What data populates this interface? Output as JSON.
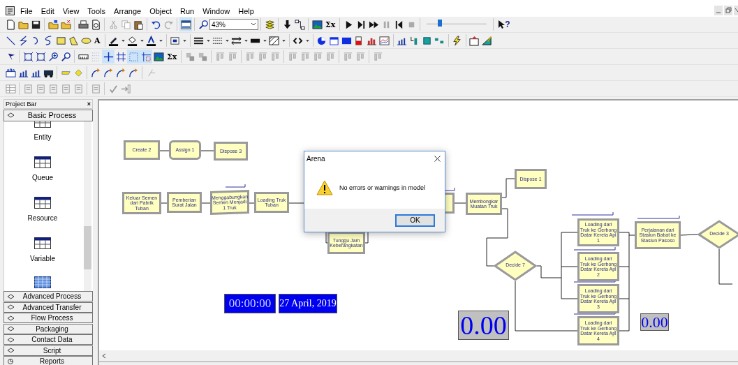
{
  "menu": [
    "File",
    "Edit",
    "View",
    "Tools",
    "Arrange",
    "Object",
    "Run",
    "Window",
    "Help"
  ],
  "toolbar": {
    "zoom": "43%",
    "speed_slider": {
      "level": 0.22
    },
    "glyphs": [
      "Σx",
      "A",
      "Σx",
      "?"
    ]
  },
  "project_bar": {
    "title": "Project Bar",
    "close": "×",
    "panels": [
      {
        "label": "Basic Process",
        "kind": "template",
        "expanded": true,
        "items": [
          "Entity",
          "Queue",
          "Resource",
          "Variable"
        ]
      },
      {
        "label": "Advanced Process",
        "kind": "template",
        "expanded": false
      },
      {
        "label": "Advanced Transfer",
        "kind": "template",
        "expanded": false
      },
      {
        "label": "Flow Process",
        "kind": "template",
        "expanded": false
      },
      {
        "label": "Packaging",
        "kind": "template",
        "expanded": false
      },
      {
        "label": "Contact Data",
        "kind": "template",
        "expanded": false
      },
      {
        "label": "Script",
        "kind": "template",
        "expanded": false
      },
      {
        "label": "Reports",
        "kind": "reports",
        "expanded": false
      }
    ]
  },
  "canvas": {
    "modules": [
      {
        "kind": "create",
        "label": "Create 2"
      },
      {
        "kind": "assign",
        "label": "Assign 1"
      },
      {
        "kind": "dispose",
        "label": "Dispose 3"
      },
      {
        "kind": "create",
        "label": "Keluar Semen dari Pabrik Tuban"
      },
      {
        "kind": "process",
        "label": "Pemberian Surat Jalan"
      },
      {
        "kind": "batch",
        "label": "Menggabungkan Semen Menjadi 1 Truk"
      },
      {
        "kind": "process",
        "label": "Loading Truk Tuban"
      },
      {
        "kind": "process",
        "label": "Tunggu Jam Keberangkatan"
      },
      {
        "kind": "process"
      },
      {
        "kind": "separate",
        "label": "Membongkar Muatan Truk"
      },
      {
        "kind": "dispose",
        "label": "Dispose 1"
      },
      {
        "kind": "decide",
        "label": "Decide 7"
      },
      {
        "kind": "process",
        "label": "Loading dari Truk ke Gerbong Datar Kereta Api 1"
      },
      {
        "kind": "process",
        "label": "Loading dari Truk ke Gerbong Datar Kereta Api 2"
      },
      {
        "kind": "process",
        "label": "Loading dari Truk ke Gerbong Datar Kereta Api 3"
      },
      {
        "kind": "process",
        "label": "Loading dari Truk ke Gerbong Datar Kereta Api 4"
      },
      {
        "kind": "process",
        "label": "Perjalanan dari Stasiun Babat ke Stasiun Pasoso"
      },
      {
        "kind": "decide",
        "label": "Decide 3"
      }
    ],
    "displays": [
      {
        "kind": "clock",
        "text": "00:00:00"
      },
      {
        "kind": "date",
        "text": "27 April, 2019"
      },
      {
        "kind": "variable",
        "text": "0.00"
      },
      {
        "kind": "variable",
        "text": "0.00"
      }
    ]
  },
  "dialog": {
    "title": "Arena",
    "message": "No errors or warnings in model",
    "button": "OK"
  }
}
